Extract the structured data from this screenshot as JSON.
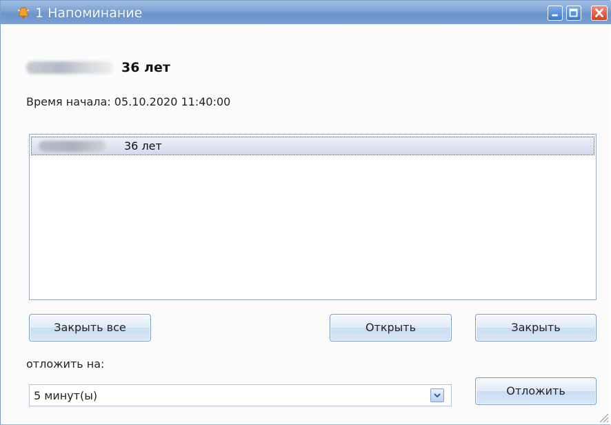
{
  "window": {
    "title": "1 Напоминание"
  },
  "patient": {
    "age": "36 лет"
  },
  "start_time": "Время начала: 05.10.2020 11:40:00",
  "list": {
    "items": [
      {
        "age": "36 лет"
      }
    ]
  },
  "buttons": {
    "close_all": "Закрыть все",
    "open": "Открыть",
    "close": "Закрыть",
    "postpone": "Отложить"
  },
  "postpone": {
    "label": "отложить на:",
    "selected": "5 минут(ы)"
  },
  "icons": {
    "title": "reminder-bell-icon",
    "minimize": "minimize-icon",
    "maximize": "maximize-icon",
    "close": "close-icon",
    "dropdown": "chevron-down-icon",
    "resize": "resize-grip-icon"
  },
  "colors": {
    "titlebar": "#7da2d2",
    "close_button": "#d3401f",
    "selection": "#d5d9ec",
    "button_border": "#7a9cc4"
  }
}
